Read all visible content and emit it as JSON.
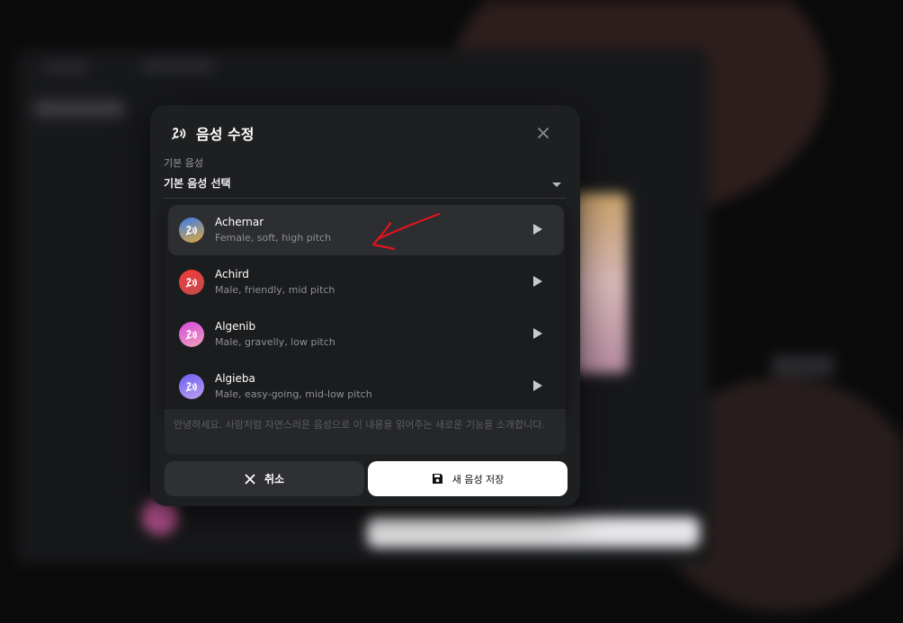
{
  "dialog": {
    "title": "음성 수정",
    "close_icon": "close-icon",
    "field_label": "기본 음성",
    "select_value": "기본 음성 선택",
    "voices": [
      {
        "name": "Achernar",
        "description": "Female, soft, high pitch",
        "selected": true,
        "gradient": [
          "#3a7bf0",
          "#e0a83a"
        ]
      },
      {
        "name": "Achird",
        "description": "Male, friendly, mid pitch",
        "selected": false,
        "gradient": [
          "#f03a3a",
          "#c74a4a"
        ]
      },
      {
        "name": "Algenib",
        "description": "Male, gravelly, low pitch",
        "selected": false,
        "gradient": [
          "#d44ae0",
          "#f0a0b8"
        ]
      },
      {
        "name": "Algieba",
        "description": "Male, easy-going, mid-low pitch",
        "selected": false,
        "gradient": [
          "#6a5ef0",
          "#c0a0f0"
        ]
      }
    ],
    "sample_text": "안녕하세요. 사람처럼 자연스러운 음성으로 이 내용을 읽어주는 새로운 기능을 소개합니다.",
    "cancel_label": "취소",
    "save_label": "새 음성 저장"
  },
  "colors": {
    "dialog_bg": "#1e1f21",
    "selected_row": "#2d2e31",
    "save_button_bg": "#ffffff",
    "cancel_button_bg": "#2f3033",
    "annotation_arrow": "#e0141e"
  }
}
